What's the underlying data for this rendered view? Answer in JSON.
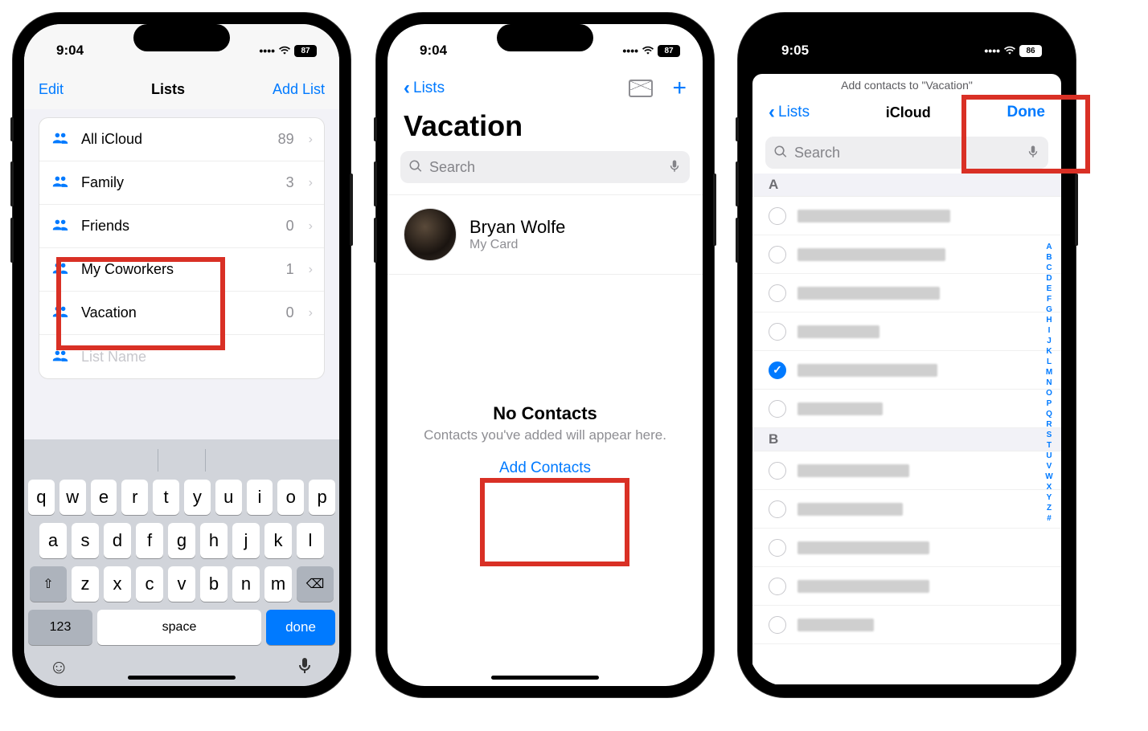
{
  "highlight_color": "#d93025",
  "accent_color": "#007aff",
  "phone1": {
    "status": {
      "time": "9:04",
      "battery": "87"
    },
    "nav": {
      "left": "Edit",
      "title": "Lists",
      "right": "Add List"
    },
    "lists": [
      {
        "name": "All iCloud",
        "count": "89"
      },
      {
        "name": "Family",
        "count": "3"
      },
      {
        "name": "Friends",
        "count": "0"
      },
      {
        "name": "My Coworkers",
        "count": "1"
      },
      {
        "name": "Vacation",
        "count": "0"
      }
    ],
    "placeholder_row": "List Name",
    "keyboard": {
      "row1": [
        "q",
        "w",
        "e",
        "r",
        "t",
        "y",
        "u",
        "i",
        "o",
        "p"
      ],
      "row2": [
        "a",
        "s",
        "d",
        "f",
        "g",
        "h",
        "j",
        "k",
        "l"
      ],
      "row3": [
        "z",
        "x",
        "c",
        "v",
        "b",
        "n",
        "m"
      ],
      "num_key": "123",
      "space_key": "space",
      "done_key": "done"
    }
  },
  "phone2": {
    "status": {
      "time": "9:04",
      "battery": "87"
    },
    "back": "Lists",
    "title": "Vacation",
    "search_placeholder": "Search",
    "card": {
      "name": "Bryan Wolfe",
      "sub": "My Card"
    },
    "empty": {
      "title": "No Contacts",
      "sub": "Contacts you've added will appear here.",
      "action": "Add Contacts"
    }
  },
  "phone3": {
    "status": {
      "time": "9:05",
      "battery": "86"
    },
    "sheet_title": "Add contacts to \"Vacation\"",
    "back": "Lists",
    "center": "iCloud",
    "done": "Done",
    "search_placeholder": "Search",
    "sections": [
      {
        "letter": "A",
        "rows": [
          false,
          false,
          false,
          false,
          true,
          false
        ]
      },
      {
        "letter": "B",
        "rows": [
          false,
          false,
          false,
          false,
          false
        ]
      }
    ],
    "index": [
      "A",
      "B",
      "C",
      "D",
      "E",
      "F",
      "G",
      "H",
      "I",
      "J",
      "K",
      "L",
      "M",
      "N",
      "O",
      "P",
      "Q",
      "R",
      "S",
      "T",
      "U",
      "V",
      "W",
      "X",
      "Y",
      "Z",
      "#"
    ]
  }
}
